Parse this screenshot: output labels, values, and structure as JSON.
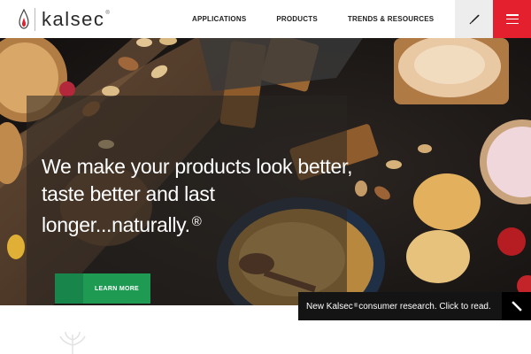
{
  "header": {
    "logo_text": "kalsec",
    "logo_reg": "®",
    "nav": [
      {
        "label": "APPLICATIONS"
      },
      {
        "label": "PRODUCTS"
      },
      {
        "label": "TRENDS & RESOURCES"
      }
    ],
    "search_icon": "pen-search-icon",
    "menu_icon": "hamburger-menu-icon"
  },
  "hero": {
    "headline_lines": [
      "We make your products look better,",
      "taste better and last",
      "longer...naturally."
    ],
    "headline_reg": "®",
    "cta_label": "LEARN MORE"
  },
  "notice": {
    "text_before": "New Kalsec",
    "reg": "®",
    "text_after": " consumer research. Click to read.",
    "icon": "pencil-icon"
  },
  "colors": {
    "brand_red": "#e5202e",
    "cta_green": "#1f9a52",
    "notice_bg": "#141414"
  }
}
